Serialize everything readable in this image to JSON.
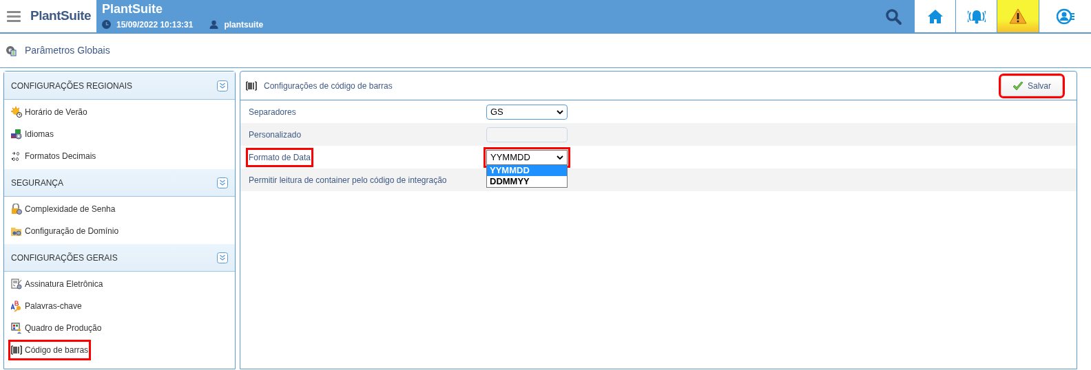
{
  "header": {
    "logo": "PlantSuite",
    "title": "PlantSuite",
    "datetime": "15/09/2022 10:13:31",
    "user": "plantsuite"
  },
  "toolbar": [
    {
      "kind": "search"
    },
    {
      "kind": "home"
    },
    {
      "kind": "alarm"
    },
    {
      "kind": "warning"
    },
    {
      "kind": "user"
    }
  ],
  "page_title": "Parâmetros Globais",
  "sidebar": [
    {
      "title": "CONFIGURAÇÕES REGIONAIS",
      "items": [
        {
          "label": "Horário de Verão",
          "kind": "sun",
          "highlighted": false
        },
        {
          "label": "Idiomas",
          "kind": "flags",
          "highlighted": false
        },
        {
          "label": "Formatos Decimais",
          "kind": "decimal",
          "highlighted": false
        }
      ]
    },
    {
      "title": "SEGURANÇA",
      "items": [
        {
          "label": "Complexidade de Senha",
          "kind": "lock",
          "highlighted": false
        },
        {
          "label": "Configuração de Domínio",
          "kind": "folder",
          "highlighted": false
        }
      ]
    },
    {
      "title": "CONFIGURAÇÕES GERAIS",
      "items": [
        {
          "label": "Assinatura Eletrônica",
          "kind": "document",
          "highlighted": false
        },
        {
          "label": "Palavras-chave",
          "kind": "key",
          "highlighted": false
        },
        {
          "label": "Quadro de Produção",
          "kind": "board",
          "highlighted": false
        },
        {
          "label": "Código de barras",
          "kind": "barcode",
          "highlighted": true
        }
      ]
    }
  ],
  "panel": {
    "title": "Configurações de código de barras",
    "save_button": {
      "label": "Salvar",
      "highlighted": true
    },
    "fields": [
      {
        "label": "Separadores",
        "kind": "select",
        "value": "GS",
        "highlighted": false
      },
      {
        "label": "Personalizado",
        "kind": "text",
        "disabled": true,
        "highlighted": false
      },
      {
        "label": "Formato de Data",
        "kind": "select",
        "value": "YYMMDD",
        "highlighted": true,
        "options": [
          {
            "label": "YYMMDD",
            "selected": true
          },
          {
            "label": "DDMMYY",
            "selected": false
          }
        ]
      },
      {
        "label": "Permitir leitura de container pelo código de integração",
        "kind": "covered",
        "highlighted": false
      }
    ]
  }
}
